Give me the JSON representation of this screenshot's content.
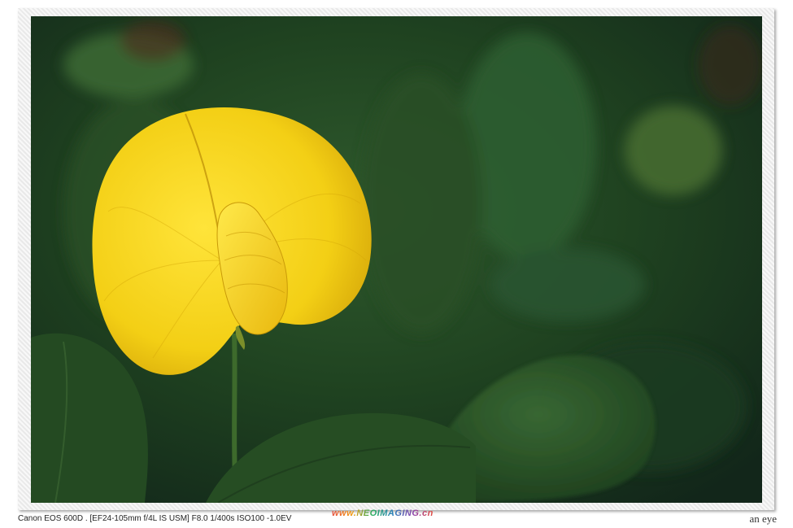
{
  "photo": {
    "subject": "yellow peanut flower",
    "caption": "Canon EOS 600D . [EF24-105mm f/4L IS USM] F8.0 1/400s ISO100 -1.0EV",
    "watermark": "www.NEOIMAGING.cn",
    "signature": "an eye"
  },
  "colors": {
    "background": "#ffffff",
    "petal": "#f2d21e",
    "leaf": "#2e5a2c",
    "bokeh": "#1b3a1f"
  }
}
